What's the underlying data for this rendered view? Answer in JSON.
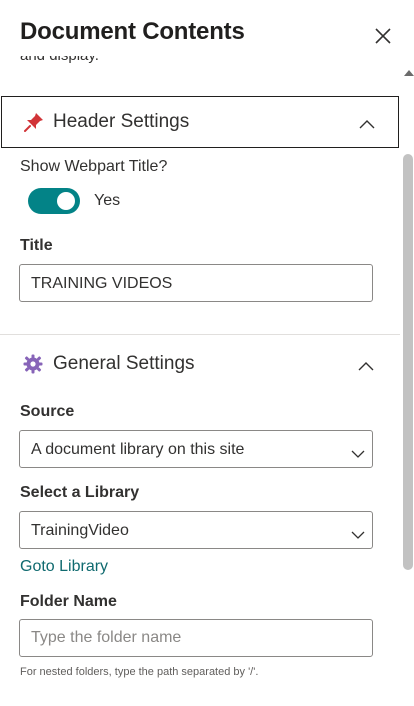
{
  "panel": {
    "title": "Document Contents",
    "clipped_description": "and display."
  },
  "icons": {
    "close": "close-icon",
    "header_section": "pushpin-icon",
    "general_section": "gear-icon",
    "collapse": "chevron-up-icon",
    "dropdown": "chevron-down-icon"
  },
  "colors": {
    "toggle_on": "#038387",
    "link": "#0f6a6f",
    "section_icon_red": "#d13438",
    "gear": "#8764b8"
  },
  "header_settings": {
    "label": "Header Settings",
    "show_title_label": "Show Webpart Title?",
    "toggle_state": "Yes",
    "title_label": "Title",
    "title_value": "TRAINING VIDEOS"
  },
  "general_settings": {
    "label": "General Settings",
    "source_label": "Source",
    "source_value": "A document library on this site",
    "library_label": "Select a Library",
    "library_value": "TrainingVideo",
    "goto_link": "Goto Library",
    "folder_label": "Folder Name",
    "folder_placeholder": "Type the folder name",
    "folder_help": "For nested folders, type the path separated by '/'."
  }
}
